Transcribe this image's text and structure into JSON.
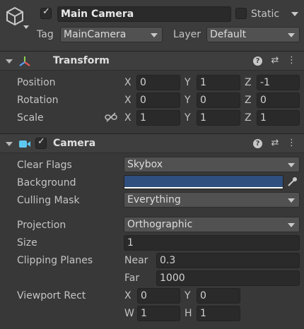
{
  "gameobject": {
    "name": "Main Camera",
    "active": true,
    "static_label": "Static",
    "static": false,
    "tag_label": "Tag",
    "tag_value": "MainCamera",
    "layer_label": "Layer",
    "layer_value": "Default"
  },
  "transform": {
    "title": "Transform",
    "rows": [
      {
        "label": "Position",
        "x": "0",
        "y": "1",
        "z": "-1"
      },
      {
        "label": "Rotation",
        "x": "0",
        "y": "0",
        "z": "0"
      },
      {
        "label": "Scale",
        "x": "1",
        "y": "1",
        "z": "1"
      }
    ],
    "axis_x": "X",
    "axis_y": "Y",
    "axis_z": "Z"
  },
  "camera": {
    "title": "Camera",
    "enabled": true,
    "clear_flags_label": "Clear Flags",
    "clear_flags_value": "Skybox",
    "background_label": "Background",
    "background_color": "#2f4f7f",
    "culling_mask_label": "Culling Mask",
    "culling_mask_value": "Everything",
    "projection_label": "Projection",
    "projection_value": "Orthographic",
    "size_label": "Size",
    "size_value": "1",
    "clipping_label": "Clipping Planes",
    "near_label": "Near",
    "near_value": "0.3",
    "far_label": "Far",
    "far_value": "1000",
    "viewport_label": "Viewport Rect",
    "viewport_x_label": "X",
    "viewport_x": "0",
    "viewport_y_label": "Y",
    "viewport_y": "0",
    "viewport_w_label": "W",
    "viewport_w": "1",
    "viewport_h_label": "H",
    "viewport_h": "1"
  },
  "icons": {
    "checkmark": "✓",
    "help": "?",
    "presets": "⇄",
    "menu": "⋮"
  },
  "colors": {
    "panel": "#383838",
    "field": "#2a2a2a",
    "dropdown": "#515151",
    "camera_icon": "#5ec8f0"
  }
}
